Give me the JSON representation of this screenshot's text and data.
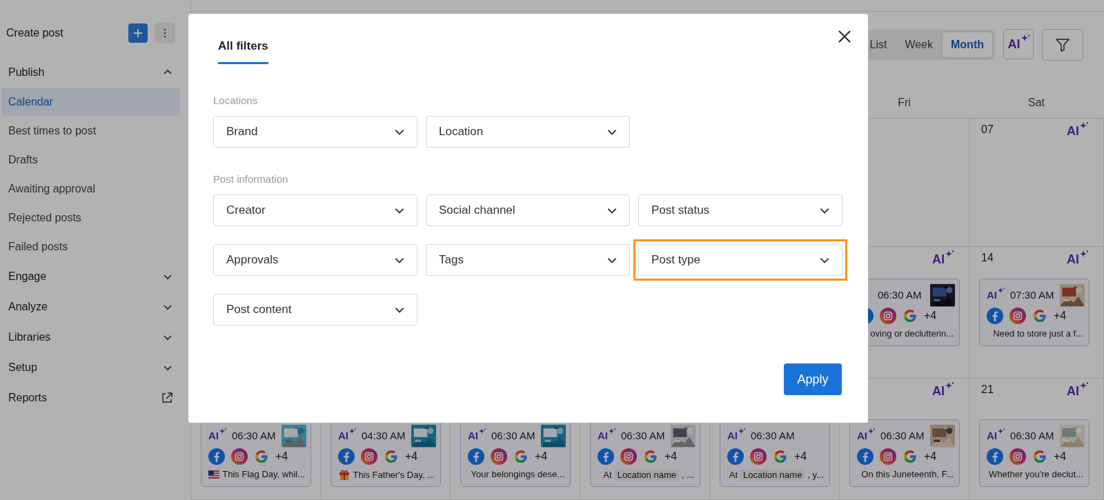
{
  "sidebar": {
    "create_label": "Create post",
    "nav": [
      {
        "label": "Publish",
        "kind": "section",
        "expanded": true,
        "children": [
          {
            "label": "Calendar",
            "selected": true
          },
          {
            "label": "Best times to post",
            "selected": false
          },
          {
            "label": "Drafts",
            "selected": false
          },
          {
            "label": "Awaiting approval",
            "selected": false
          },
          {
            "label": "Rejected posts",
            "selected": false
          },
          {
            "label": "Failed posts",
            "selected": false
          }
        ]
      },
      {
        "label": "Engage",
        "kind": "section",
        "expanded": false
      },
      {
        "label": "Analyze",
        "kind": "section",
        "expanded": false
      },
      {
        "label": "Libraries",
        "kind": "section",
        "expanded": false
      },
      {
        "label": "Setup",
        "kind": "section",
        "expanded": false
      },
      {
        "label": "Reports",
        "kind": "link"
      }
    ]
  },
  "toolbar": {
    "views": [
      {
        "label": "List",
        "selected": false
      },
      {
        "label": "Week",
        "selected": false
      },
      {
        "label": "Month",
        "selected": true
      }
    ],
    "ai_button": "AI"
  },
  "calendar": {
    "weekdays": [
      "Fri",
      "Sat"
    ],
    "weeks": [
      [
        {
          "date": "07",
          "ai": "AI"
        }
      ],
      [
        {
          "ai": "AI",
          "posts": [
            {
              "time": "06:30 AM",
              "thumbnail": {
                "kind": "picture"
              },
              "more": "+4",
              "caption": [
                {
                  "kind": "text",
                  "text": "oving or declutterin..."
                }
              ]
            }
          ]
        },
        {
          "date": "14",
          "ai": "AI",
          "posts": [
            {
              "ai": "AI",
              "time": "07:30 AM",
              "thumbnail": {
                "kind": "picture"
              },
              "more": "+4",
              "caption": [
                {
                  "kind": "text",
                  "text": "Need to store just a f..."
                }
              ]
            }
          ]
        }
      ],
      [
        {
          "posts": [
            {
              "ai": "AI",
              "time": "06:30 AM",
              "thumbnail": {
                "kind": "picture"
              },
              "more": "+4",
              "caption": [
                {
                  "kind": "flag"
                },
                {
                  "kind": "text",
                  "text": "This Flag Day, whil..."
                }
              ]
            }
          ]
        },
        {
          "posts": [
            {
              "ai": "AI",
              "time": "04:30 AM",
              "thumbnail": {
                "kind": "picture"
              },
              "more": "+4",
              "caption": [
                {
                  "kind": "gift"
                },
                {
                  "kind": "text",
                  "text": "This Father's Day, ..."
                }
              ]
            }
          ]
        },
        {
          "posts": [
            {
              "ai": "AI",
              "time": "06:30 AM",
              "thumbnail": {
                "kind": "picture"
              },
              "more": "+4",
              "caption": [
                {
                  "kind": "text",
                  "text": "Your belongings dese..."
                }
              ]
            }
          ]
        },
        {
          "posts": [
            {
              "ai": "AI",
              "time": "06:30 AM",
              "thumbnail": {
                "kind": "picture"
              },
              "more": "+4",
              "caption": [
                {
                  "kind": "text",
                  "text": "At"
                },
                {
                  "kind": "chip",
                  "text": "Location name"
                },
                {
                  "kind": "text",
                  "text": ", ..."
                }
              ]
            }
          ]
        },
        {
          "posts": [
            {
              "ai": "AI",
              "time": "06:30 AM",
              "more": "+4",
              "caption": [
                {
                  "kind": "text",
                  "text": "At"
                },
                {
                  "kind": "chip",
                  "text": "Location name"
                },
                {
                  "kind": "text",
                  "text": ", y..."
                }
              ]
            }
          ]
        },
        {
          "ai": "AI",
          "posts": [
            {
              "ai": "AI",
              "time": "06:30 AM",
              "thumbnail": {
                "kind": "picture"
              },
              "more": "+4",
              "caption": [
                {
                  "kind": "text",
                  "text": "On this Juneteenth, F..."
                }
              ]
            }
          ]
        },
        {
          "date": "21",
          "ai": "AI",
          "posts": [
            {
              "ai": "AI",
              "time": "06:30 AM",
              "thumbnail": {
                "kind": "picture"
              },
              "more": "+4",
              "caption": [
                {
                  "kind": "text",
                  "text": "Whether you're declut..."
                }
              ]
            }
          ]
        }
      ]
    ]
  },
  "modal": {
    "tabs": [
      {
        "label": "All filters",
        "selected": true
      }
    ],
    "sections": [
      {
        "label": "Locations",
        "filters": [
          {
            "label": "Brand",
            "highlighted": false
          },
          {
            "label": "Location",
            "highlighted": false
          }
        ]
      },
      {
        "label": "Post information",
        "filters": [
          {
            "label": "Creator",
            "highlighted": false
          },
          {
            "label": "Social channel",
            "highlighted": false
          },
          {
            "label": "Post status",
            "highlighted": false
          },
          {
            "label": "Approvals",
            "highlighted": false
          },
          {
            "label": "Tags",
            "highlighted": false
          },
          {
            "label": "Post type",
            "highlighted": true
          },
          {
            "label": "Post content",
            "highlighted": false
          }
        ]
      }
    ],
    "apply": "Apply"
  }
}
